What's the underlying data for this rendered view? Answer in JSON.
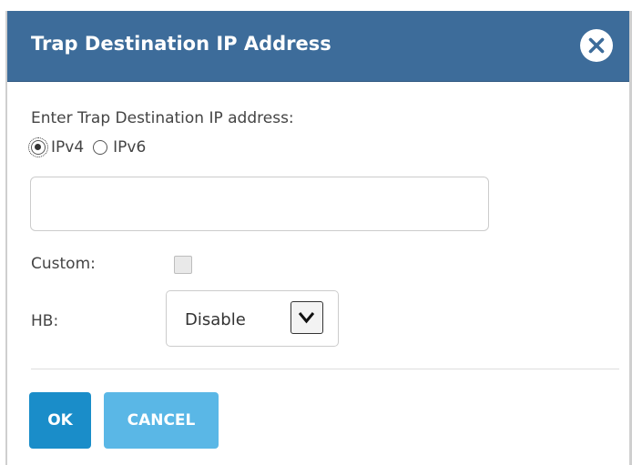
{
  "dialog": {
    "title": "Trap Destination IP Address",
    "close_icon": "close-icon"
  },
  "form": {
    "prompt": "Enter Trap Destination IP address:",
    "ip_version": {
      "options": [
        {
          "label": "IPv4",
          "checked": true
        },
        {
          "label": "IPv6",
          "checked": false
        }
      ]
    },
    "ip_address": {
      "value": "",
      "placeholder": ""
    },
    "custom": {
      "label": "Custom:",
      "checked": false
    },
    "hb": {
      "label": "HB:",
      "selected": "Disable"
    }
  },
  "buttons": {
    "ok": "OK",
    "cancel": "CANCEL"
  },
  "colors": {
    "titlebar": "#3d6c9a",
    "ok_button": "#1a8dc9",
    "cancel_button": "#5ab7e6"
  }
}
